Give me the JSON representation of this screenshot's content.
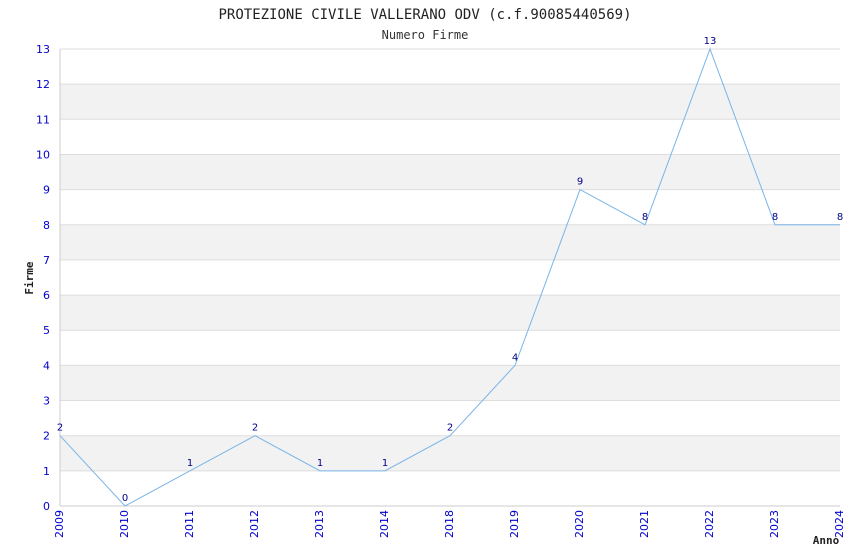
{
  "chart_data": {
    "type": "line",
    "title": "PROTEZIONE CIVILE VALLERANO ODV (c.f.90085440569)",
    "subtitle": "Numero Firme",
    "xlabel": "Anno",
    "ylabel": "Firme",
    "categories": [
      "2009",
      "2010",
      "2011",
      "2012",
      "2013",
      "2014",
      "2018",
      "2019",
      "2020",
      "2021",
      "2022",
      "2023",
      "2024"
    ],
    "values": [
      2,
      0,
      1,
      2,
      1,
      1,
      2,
      4,
      9,
      8,
      13,
      8,
      8
    ],
    "ylim": [
      0,
      13
    ],
    "yticks": [
      0,
      1,
      2,
      3,
      4,
      5,
      6,
      7,
      8,
      9,
      10,
      11,
      12,
      13
    ],
    "grid": "horizontal alternating bands",
    "colors": {
      "line": "#7ab4e8",
      "band": "#f2f2f2",
      "gridline": "#dddddd",
      "tick_text": "#0000cc",
      "data_label": "#000088"
    }
  }
}
